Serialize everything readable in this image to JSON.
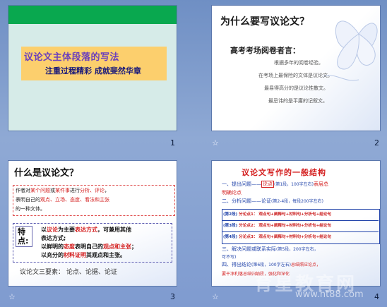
{
  "slides": [
    {
      "number": "1",
      "title": "议论文主体段落的写法",
      "subtitle": "注重过程精彩   成就斐然华章"
    },
    {
      "number": "2",
      "title": "为什么要写议论文？",
      "subtitle": "高考考场阅卷者言：",
      "lines": [
        "根据多年的阅卷经验。",
        "在考场上最保险的文体是议论文。",
        "最易得高分的是议论性散文。",
        "最忌讳的是平庸的记叙文。"
      ]
    },
    {
      "number": "3",
      "title": "什么是议论文？",
      "definition": {
        "l1_a": "作者对",
        "l1_b": "某个问题",
        "l1_c": "或",
        "l1_d": "某件事",
        "l1_e": "进行",
        "l1_f": "分析、评论",
        "l1_g": "，",
        "l2_a": "表明自己的",
        "l2_b": "观点、立场、态度、看法和主张",
        "l3": "的一种文体。"
      },
      "feature_label": "特点:",
      "features": {
        "f1_a": "以",
        "f1_b": "议论",
        "f1_c": "为主要",
        "f1_d": "表达方式",
        "f1_e": "，可兼用其他",
        "f2": "表达方式;",
        "f3_a": "以鲜明的",
        "f3_b": "态度",
        "f3_c": "表明自己的",
        "f3_d": "观点和主张",
        "f3_e": "；",
        "f4_a": "以充分的",
        "f4_b": "材料证明",
        "f4_c": "其观点和主张。"
      },
      "three_elements": "议论文三要素：  论点、论据、论证"
    },
    {
      "number": "4",
      "title": "议论文写作的一般结构",
      "lines": {
        "l1_a": "一、提出问题——",
        "l1_b": "论点",
        "l1_c": "(第1段，100字左右)",
        "l1_d": "表层总",
        "l1_e": "明确论点",
        "l2_a": "二、分析问题——",
        "l2_b": "论证",
        "l2_c": "(第2-4段，每段200字左右)",
        "grid": [
          {
            "a": "(第2段)",
            "b": "分论点1：",
            "c": "观点句+阐释句+材料句+分析句+结论句"
          },
          {
            "a": "(第3段)",
            "b": "分论点2：",
            "c": "观点句+阐释句+材料句+分析句+结论句"
          },
          {
            "a": "(第4段)",
            "b": "分论点3：",
            "c": "观点句+阐释句+材料句+分析句+结论句"
          }
        ],
        "l3_a": "三、解决问题或联系实际",
        "l3_b": "(第5段，200字左右，",
        "l3_c": "可不写)",
        "l4_a": "四、得出结论",
        "l4_b": "(第6段，100字左右)",
        "l4_c": "总结照应论点，",
        "l5": "要干净利落总结归纳段，强化和深化"
      }
    }
  ],
  "watermark": "育星教育网",
  "watermark_url": "www.ht88.com",
  "colors": {
    "background": "#7f9bd0",
    "green_bar": "#09a84f",
    "title_box": "#fccf6d",
    "accent_red": "#d42020",
    "accent_blue": "#2244aa"
  }
}
